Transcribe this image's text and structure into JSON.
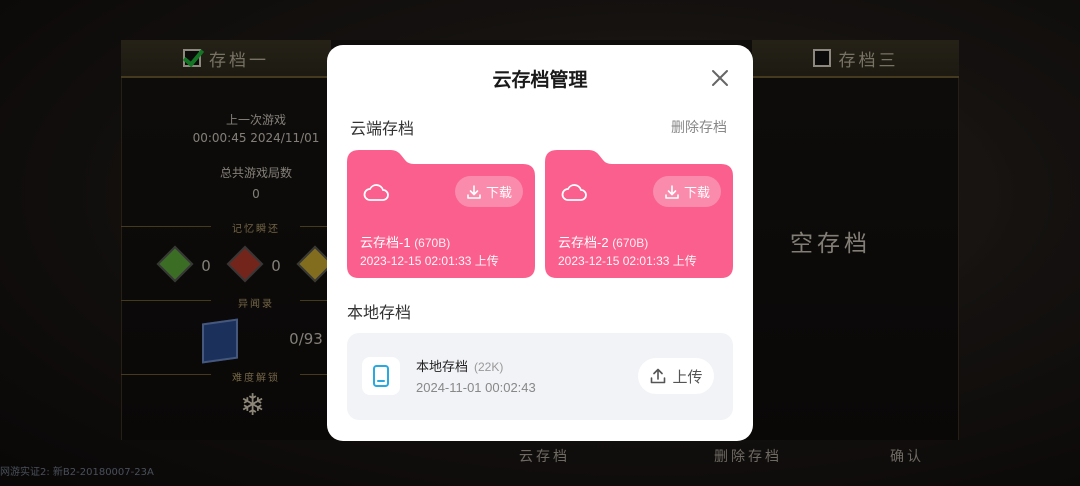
{
  "background": {
    "slot1_label": "存档一",
    "slot3_label": "存档三",
    "last_game_label": "上一次游戏",
    "last_game_time": "00:00:45 2024/11/01",
    "total_games_label": "总共游戏局数",
    "total_games_value": "0",
    "memory_label": "记忆瞬还",
    "memory_count_1": "0",
    "memory_count_2": "0",
    "records_label": "异闻录",
    "records_value": "0/93",
    "difficulty_label": "难度解锁",
    "empty_save": "空存档",
    "bottom_cloud": "云存档",
    "bottom_delete": "删除存档",
    "bottom_confirm": "确认",
    "footer": "网游实证2: 新B2-20180007-23A"
  },
  "modal": {
    "title": "云存档管理",
    "cloud_section_label": "云端存档",
    "delete_label": "删除存档",
    "cloud_saves": [
      {
        "name": "云存档-1",
        "size": "(670B)",
        "date": "2023-12-15 02:01:33 上传",
        "download_label": "下载"
      },
      {
        "name": "云存档-2",
        "size": "(670B)",
        "date": "2023-12-15 02:01:33 上传",
        "download_label": "下载"
      }
    ],
    "local_section_label": "本地存档",
    "local_save": {
      "name": "本地存档",
      "size": "(22K)",
      "date": "2024-11-01 00:02:43",
      "upload_label": "上传"
    }
  },
  "colors": {
    "folder": "#fa5f8d",
    "accent_icon": "#2aa8e0"
  },
  "icons": [
    "check-icon",
    "close-icon",
    "cloud-icon",
    "download-icon",
    "tablet-icon",
    "upload-icon",
    "snowflake-icon"
  ]
}
